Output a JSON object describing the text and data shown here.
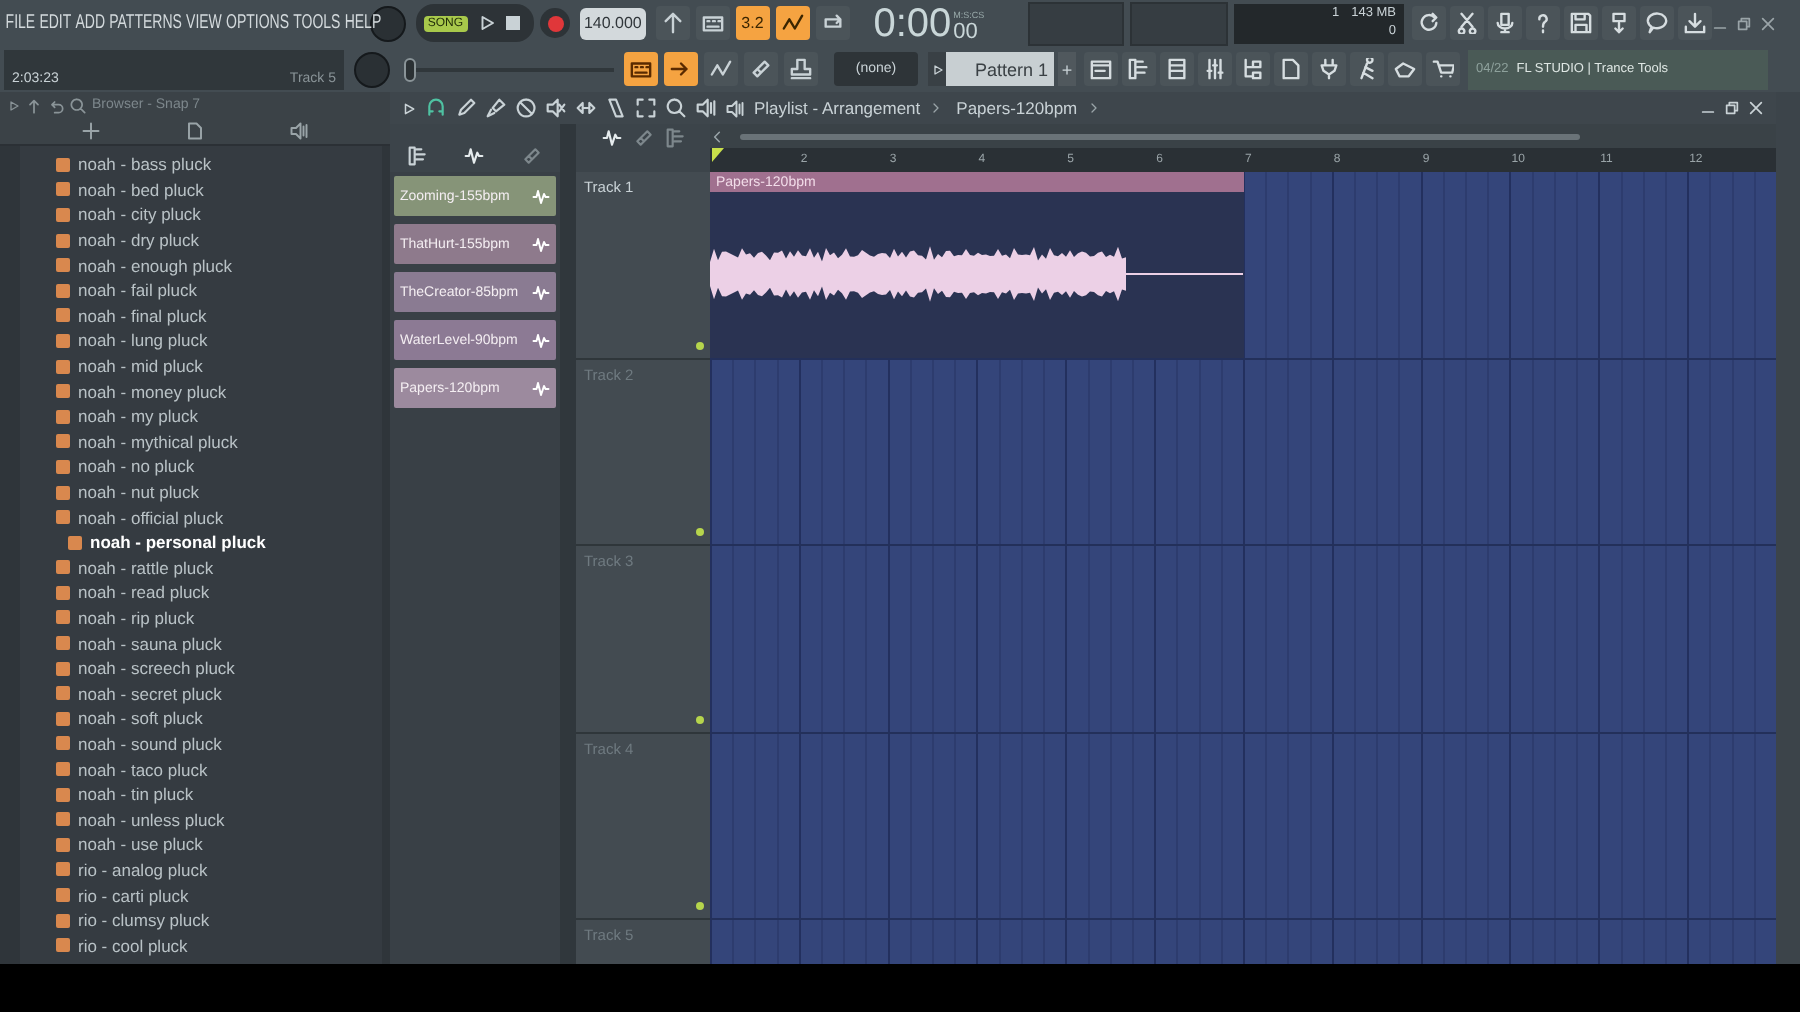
{
  "menu": [
    "FILE",
    "EDIT",
    "ADD",
    "PATTERNS",
    "VIEW",
    "OPTIONS",
    "TOOLS",
    "HELP"
  ],
  "hint": {
    "time": "2:03:23",
    "track": "Track 5"
  },
  "transport": {
    "mode": "SONG",
    "song_mode": true,
    "tempo": "140.000",
    "time": "0:00",
    "time_sub": "00",
    "time_unit": "M:S:CS"
  },
  "pitch_slider": {
    "level": 0.0
  },
  "toggles_top": [
    {
      "on": false
    },
    {
      "on": false
    },
    {
      "label": "3.2",
      "on": true
    },
    {
      "on": true
    },
    {
      "on": false
    }
  ],
  "toggles_bottom": [
    {
      "on": true
    },
    {
      "on": true
    },
    {
      "on": false
    },
    {
      "on": false
    },
    {
      "on": false
    }
  ],
  "monitor": {
    "cpu": "1",
    "memory": "143 MB",
    "polyphony": "0"
  },
  "pattern": {
    "snap": "(none)",
    "name": "Pattern 1",
    "add": "+"
  },
  "news": {
    "date": "04/22",
    "text": "FL STUDIO | Trance Tools"
  },
  "browser": {
    "title": "Browser - Snap 7",
    "items": [
      {
        "label": "noah - bass pluck",
        "selected": false
      },
      {
        "label": "noah - bed pluck",
        "selected": false
      },
      {
        "label": "noah - city pluck",
        "selected": false
      },
      {
        "label": "noah - dry pluck",
        "selected": false
      },
      {
        "label": "noah - enough pluck",
        "selected": false
      },
      {
        "label": "noah - fail pluck",
        "selected": false
      },
      {
        "label": "noah - final pluck",
        "selected": false
      },
      {
        "label": "noah - lung pluck",
        "selected": false
      },
      {
        "label": "noah - mid pluck",
        "selected": false
      },
      {
        "label": "noah - money pluck",
        "selected": false
      },
      {
        "label": "noah - my pluck",
        "selected": false
      },
      {
        "label": "noah - mythical pluck",
        "selected": false
      },
      {
        "label": "noah - no pluck",
        "selected": false
      },
      {
        "label": "noah - nut pluck",
        "selected": false
      },
      {
        "label": "noah - official pluck",
        "selected": false
      },
      {
        "label": "noah - personal pluck",
        "selected": true
      },
      {
        "label": "noah - rattle pluck",
        "selected": false
      },
      {
        "label": "noah - read pluck",
        "selected": false
      },
      {
        "label": "noah - rip pluck",
        "selected": false
      },
      {
        "label": "noah - sauna pluck",
        "selected": false
      },
      {
        "label": "noah - screech pluck",
        "selected": false
      },
      {
        "label": "noah - secret pluck",
        "selected": false
      },
      {
        "label": "noah - soft pluck",
        "selected": false
      },
      {
        "label": "noah - sound pluck",
        "selected": false
      },
      {
        "label": "noah - taco pluck",
        "selected": false
      },
      {
        "label": "noah - tin pluck",
        "selected": false
      },
      {
        "label": "noah - unless pluck",
        "selected": false
      },
      {
        "label": "noah - use pluck",
        "selected": false
      },
      {
        "label": "rio - analog pluck",
        "selected": false
      },
      {
        "label": "rio - carti pluck",
        "selected": false
      },
      {
        "label": "rio - clumsy pluck",
        "selected": false
      },
      {
        "label": "rio - cool pluck",
        "selected": false
      }
    ]
  },
  "playlist": {
    "title": "Playlist - Arrangement",
    "pattern": "Papers-120bpm",
    "patterns": [
      {
        "label": "Zooming-155bpm",
        "color": "#869478"
      },
      {
        "label": "ThatHurt-155bpm",
        "color": "#8e7a8c"
      },
      {
        "label": "TheCreator-85bpm",
        "color": "#8a7b92"
      },
      {
        "label": "WaterLevel-90bpm",
        "color": "#8c7a94"
      },
      {
        "label": "Papers-120bpm",
        "color": "#9c8a9e"
      }
    ],
    "ruler": [
      "2",
      "3",
      "4",
      "5",
      "6",
      "7",
      "8",
      "9",
      "10",
      "11",
      "12"
    ],
    "tracks": [
      {
        "name": "Track 1",
        "clip": {
          "label": "Papers-120bpm"
        }
      },
      {
        "name": "Track 2"
      },
      {
        "name": "Track 3"
      },
      {
        "name": "Track 4"
      },
      {
        "name": "Track 5"
      }
    ]
  }
}
